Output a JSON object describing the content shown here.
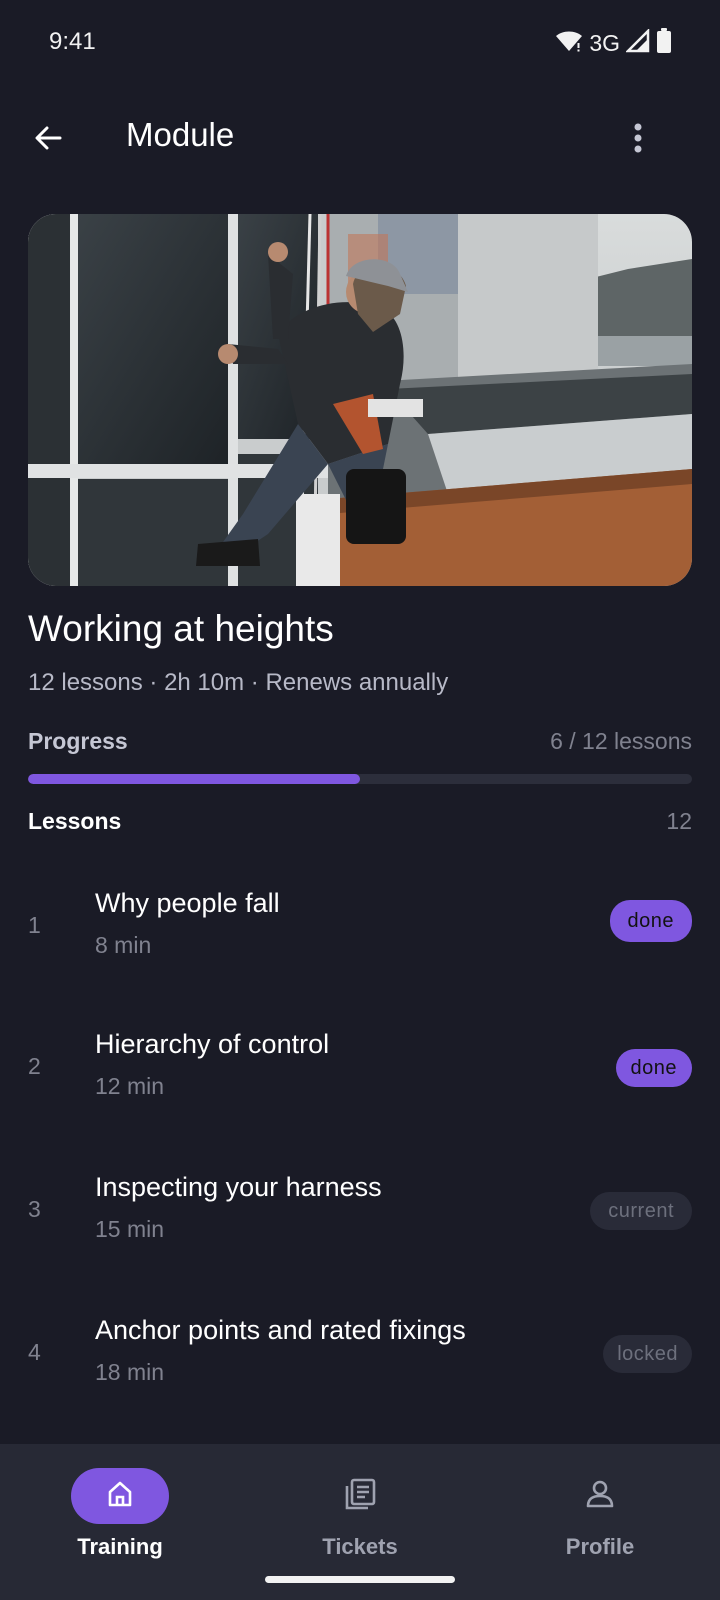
{
  "status_bar": {
    "time": "9:41",
    "network": "3G"
  },
  "app_bar": {
    "title": "Module",
    "back_icon": "arrow-back-icon",
    "more_icon": "more-vert-icon"
  },
  "hero": {
    "description": "Rope access worker cleaning building windows"
  },
  "module": {
    "title": "Working at heights",
    "meta": "12 lessons · 2h 10m · Renews annually"
  },
  "progress": {
    "label": "Progress",
    "count_text": "6 / 12 lessons",
    "completed": 6,
    "total": 12,
    "color": "#7f57e0"
  },
  "lessons": {
    "label": "Lessons",
    "count": "12",
    "items": [
      {
        "number": "1",
        "title": "Why people fall",
        "duration": "8 min",
        "status": "done"
      },
      {
        "number": "2",
        "title": "Hierarchy of control",
        "duration": "12 min",
        "status": "done"
      },
      {
        "number": "3",
        "title": "Inspecting your harness",
        "duration": "15 min",
        "status": "current"
      },
      {
        "number": "4",
        "title": "Anchor points and rated fixings",
        "duration": "18 min",
        "status": "locked"
      }
    ]
  },
  "bottom_nav": {
    "items": [
      {
        "label": "Training",
        "icon": "home-icon",
        "active": true
      },
      {
        "label": "Tickets",
        "icon": "tickets-icon",
        "active": false
      },
      {
        "label": "Profile",
        "icon": "person-icon",
        "active": false
      }
    ]
  },
  "colors": {
    "background": "#1a1b26",
    "accent": "#7f57e0",
    "nav_background": "#272935"
  }
}
